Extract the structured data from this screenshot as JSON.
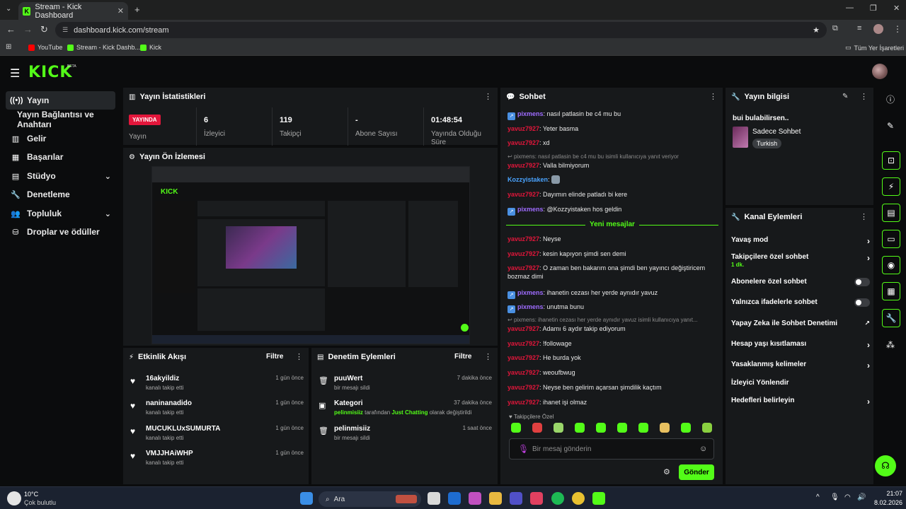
{
  "browser": {
    "tab_title": "Stream - Kick Dashboard",
    "url": "dashboard.kick.com/stream",
    "bookmarks": [
      "YouTube",
      "Stream - Kick Dashb...",
      "Kick"
    ],
    "all_bookmarks": "Tüm Yer İşaretleri"
  },
  "app": {
    "logo": "KICK",
    "beta": "BETA"
  },
  "sidebar": {
    "items": [
      {
        "label": "Yayın"
      },
      {
        "label": "Yayın Bağlantısı ve Anahtarı"
      },
      {
        "label": "Gelir"
      },
      {
        "label": "Başarılar"
      },
      {
        "label": "Stüdyo"
      },
      {
        "label": "Denetleme"
      },
      {
        "label": "Topluluk"
      },
      {
        "label": "Droplar ve ödüller"
      }
    ]
  },
  "stats": {
    "title": "Yayın İstatistikleri",
    "live_badge": "YAYINDA",
    "live_label": "Yayın",
    "viewers_value": "6",
    "viewers_label": "İzleyici",
    "followers_value": "119",
    "followers_label": "Takipçi",
    "subs_value": "-",
    "subs_label": "Abone Sayısı",
    "duration_value": "01:48:54",
    "duration_label": "Yayında Olduğu Süre"
  },
  "preview": {
    "title": "Yayın Ön İzlemesi"
  },
  "activity": {
    "title": "Etkinlik Akışı",
    "filter": "Filtre",
    "items": [
      {
        "name": "16akyildiz",
        "sub": "kanalı takip etti",
        "time": "1 gün önce"
      },
      {
        "name": "naninanadido",
        "sub": "kanalı takip etti",
        "time": "1 gün önce"
      },
      {
        "name": "MUCUKLUxSUMURTA",
        "sub": "kanalı takip etti",
        "time": "1 gün önce"
      },
      {
        "name": "VMJJHAiWHP",
        "sub": "kanalı takip etti",
        "time": "1 gün önce"
      }
    ]
  },
  "moderation": {
    "title": "Denetim Eylemleri",
    "filter": "Filtre",
    "items": [
      {
        "name": "puuWert",
        "sub": "bir mesajı sildi",
        "time": "7 dakika önce"
      },
      {
        "name": "Kategori",
        "sub_a": "pelinmisiiz",
        "sub_b": " tarafından ",
        "sub_c": "Just Chatting",
        "sub_d": " olarak değiştirildi",
        "time": "37 dakika önce"
      },
      {
        "name": "pelinmisiiz",
        "sub": "bir mesajı sildi",
        "time": "1 saat önce"
      }
    ]
  },
  "chat": {
    "title": "Sohbet",
    "messages": [
      {
        "user": "pixmens",
        "text": ": nasıl patlasin be c4 mu bu"
      },
      {
        "user": "yavuz7927",
        "text": ": Yeter basma"
      },
      {
        "user": "yavuz7927",
        "text": ": xd"
      },
      {
        "reply": "pixmens: nasıl patlasin be c4 mu bu isimli kullanıcıya yanıt veriyor"
      },
      {
        "user": "yavuz7927",
        "text": ": Valla bilmiyorum"
      },
      {
        "user": "Kozzyistaken",
        "text": ":"
      },
      {
        "user": "yavuz7927",
        "text": ": Dayımın elinde patladı bi kere"
      },
      {
        "user": "pixmens",
        "text": ": @Kozzyistaken hos geldin"
      },
      {
        "user": "yavuz7927",
        "text": ": Neyse"
      },
      {
        "user": "yavuz7927",
        "text": ": kesin kapıyon şimdi sen demi"
      },
      {
        "user": "yavuz7927",
        "text": ": O zaman ben bakarım ona şimdi ben yayıncı değiştiricem bozmaz dimi"
      },
      {
        "user": "pixmens",
        "text": ": ihanetin cezası her yerde aynıdır yavuz"
      },
      {
        "user": "pixmens",
        "text": ": unutma bunu"
      },
      {
        "reply": "pixmens: ihanetin cezası her yerde aynıdır yavuz isimli kullanıcıya yanıt..."
      },
      {
        "user": "yavuz7927",
        "text": ": Adamı 6 aydır takip ediyorum"
      },
      {
        "user": "yavuz7927",
        "text": ": !followage"
      },
      {
        "user": "yavuz7927",
        "text": ": He burda yok"
      },
      {
        "user": "yavuz7927",
        "text": ": weoufbwug"
      },
      {
        "user": "yavuz7927",
        "text": ": Neyse ben gelirim açarsan şimdilik kaçtım"
      },
      {
        "user": "yavuz7927",
        "text": ": ihanet işi olmaz"
      }
    ],
    "new_messages": "Yeni mesajlar",
    "followers_only": "Takipçilere Özel",
    "input_placeholder": "Bir mesaj gönderin",
    "send": "Gönder"
  },
  "stream_info": {
    "title": "Yayın bilgisi",
    "stream_title": "bui bulabilirsen..",
    "category": "Sadece Sohbet",
    "language": "Turkish"
  },
  "channel_actions": {
    "title": "Kanal Eylemleri",
    "items": [
      {
        "label": "Yavaş mod"
      },
      {
        "label": "Takipçilere özel sohbet",
        "sub": "1 dk."
      },
      {
        "label": "Abonelere özel sohbet"
      },
      {
        "label": "Yalnızca ifadelerle sohbet"
      },
      {
        "label": "Yapay Zeka ile Sohbet Denetimi"
      },
      {
        "label": "Hesap yaşı kısıtlaması"
      },
      {
        "label": "Yasaklanmış kelimeler"
      },
      {
        "label": "İzleyici Yönlendir"
      },
      {
        "label": "Hedefleri belirleyin"
      }
    ]
  },
  "taskbar": {
    "temp": "10°C",
    "weather": "Çok bulutlu",
    "search": "Ara",
    "time": "21:07",
    "date": "8.02.2026"
  }
}
